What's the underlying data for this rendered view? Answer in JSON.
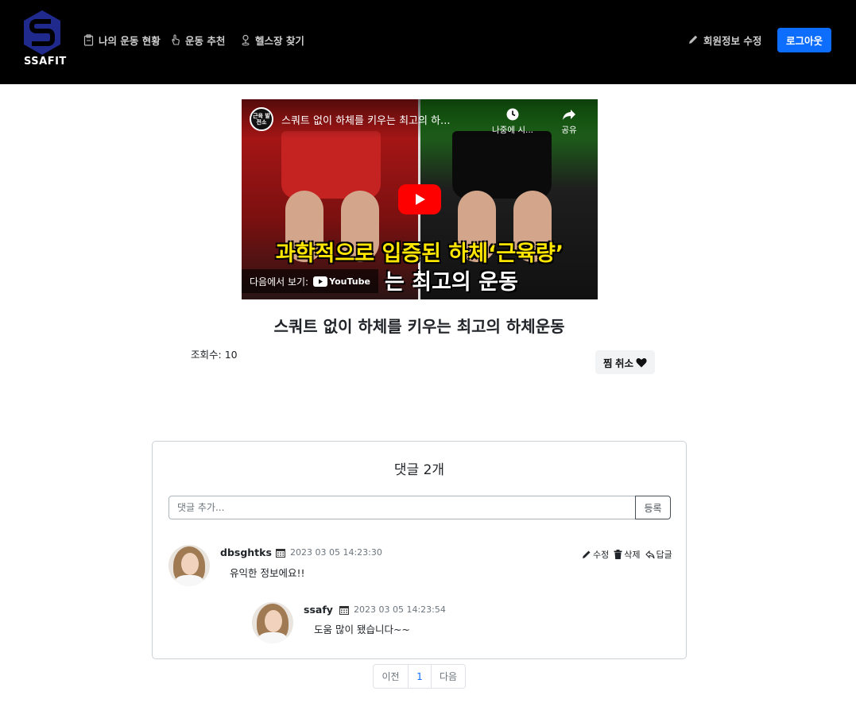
{
  "brand": {
    "name": "SSAFIT",
    "color": "#1f2a8c"
  },
  "nav": {
    "items": [
      {
        "label": "나의 운동 현황",
        "icon": "clipboard-icon"
      },
      {
        "label": "운동 추천",
        "icon": "hand-pointer-icon"
      },
      {
        "label": "헬스장 찾기",
        "icon": "person-pin-icon"
      }
    ],
    "edit_profile": "회원정보 수정",
    "logout": "로그아웃",
    "accent": "#0d6efd"
  },
  "video": {
    "overlay_title": "스쿼트 없이 하체를 키우는 최고의 하...",
    "channel_badge": "근육 발전소",
    "watch_later": "나중에 시...",
    "share": "공유",
    "caption_line1": "과학적으로 입증된 하체‘근육량’",
    "caption_line2": "는 최고의 운동",
    "watch_on": "다음에서 보기:",
    "youtube": "YouTube",
    "title": "스쿼트 없이 하체를 키우는 최고의 하체운동",
    "views_label": "조회수: ",
    "views": "10",
    "like_button": "찜 취소"
  },
  "comments": {
    "title": "댓글 2개",
    "input_placeholder": "댓글 추가...",
    "submit": "등록",
    "actions": {
      "edit": "수정",
      "delete": "삭제",
      "reply": "답글"
    },
    "items": [
      {
        "author": "dbsghtks",
        "date": "2023 03 05 14:23:30",
        "text": "유익한 정보에요!!"
      },
      {
        "author": "ssafy",
        "date": "2023 03 05 14:23:54",
        "text": "도움 많이 됐습니다~~"
      }
    ]
  },
  "pagination": {
    "prev": "이전",
    "current": "1",
    "next": "다음"
  }
}
